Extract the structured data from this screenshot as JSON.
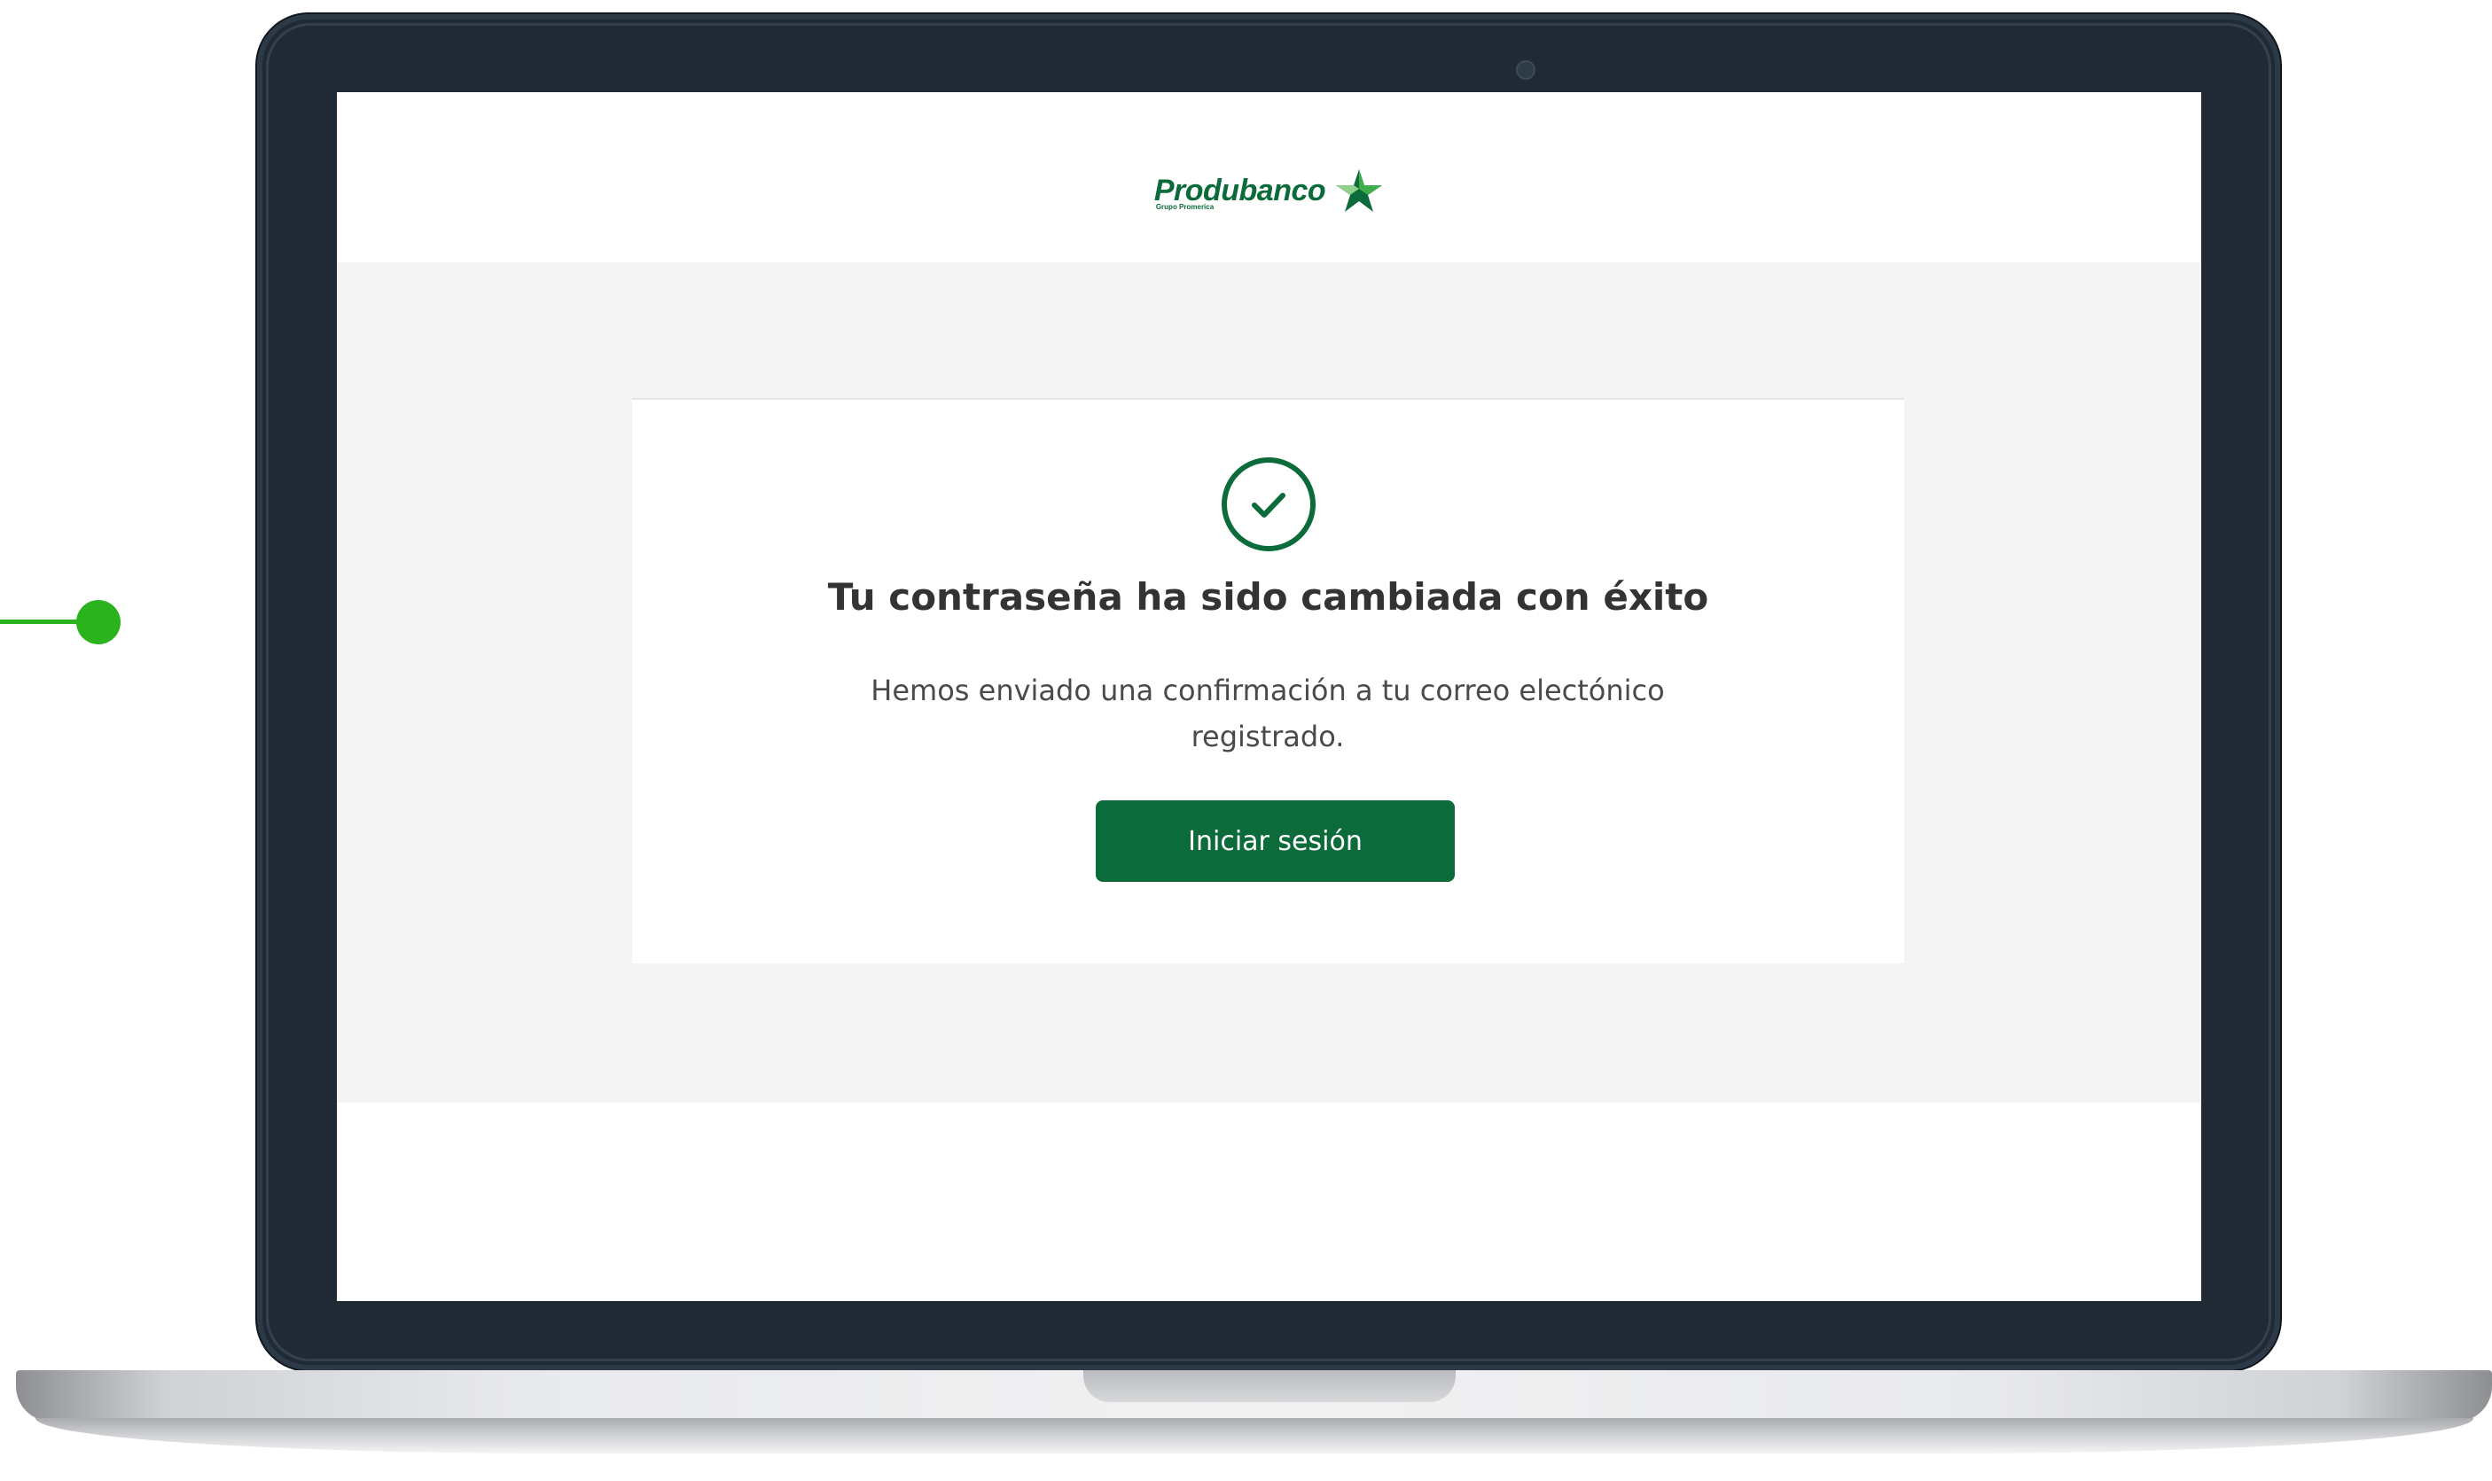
{
  "brand": {
    "name": "Produbanco",
    "tagline": "Grupo Promerica",
    "primary_color": "#0c6b3a",
    "callout_color": "#2ab31c"
  },
  "success": {
    "icon": "check-circle-icon",
    "title": "Tu contraseña ha sido cambiada con éxito",
    "message": "Hemos enviado una confirmación a tu correo electónico registrado."
  },
  "actions": {
    "login_label": "Iniciar sesión"
  }
}
